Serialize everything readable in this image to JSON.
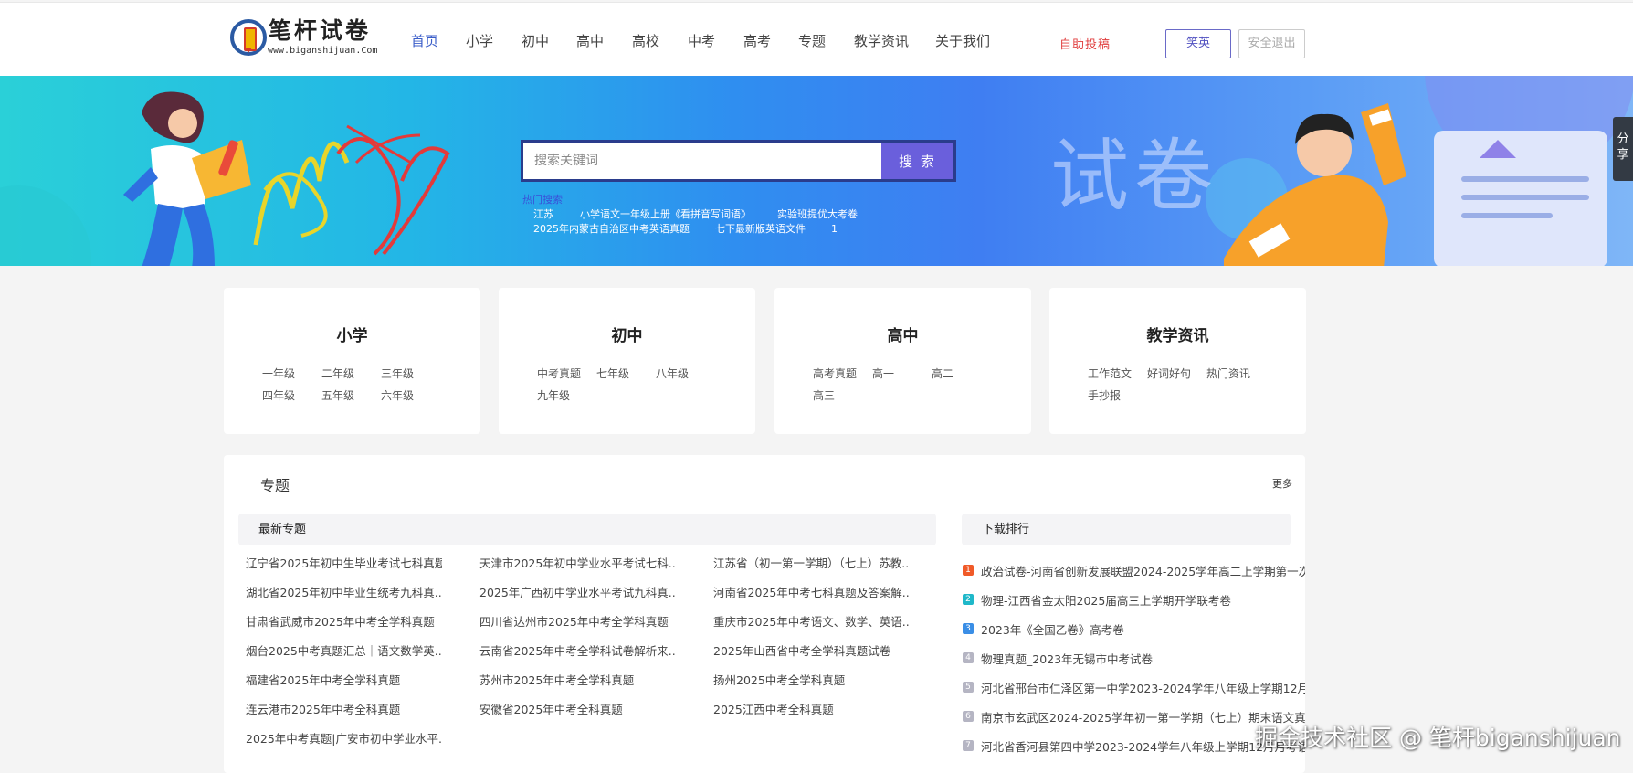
{
  "header": {
    "logo_text": "笔杆试卷",
    "logo_url": "www.biganshijuan.Com",
    "nav": [
      "首页",
      "小学",
      "初中",
      "高中",
      "高校",
      "中考",
      "高考",
      "专题",
      "教学资讯",
      "关于我们"
    ],
    "nav_active": "首页",
    "contribute": "自助投稿",
    "user_button": "笑英",
    "logout_button": "安全退出"
  },
  "banner": {
    "big_text": "试卷",
    "search_placeholder": "搜索关键词",
    "search_button": "搜 索",
    "hot_label": "热门搜索",
    "hot_links_row1": [
      "江苏",
      "小学语文一年级上册《看拼音写词语》",
      "实验班提优大考卷"
    ],
    "hot_links_row2": [
      "2025年内蒙古自治区中考英语真题",
      "七下最新版英语文件",
      "1"
    ],
    "share_label": "分享"
  },
  "cards": [
    {
      "title": "小学",
      "links": [
        "一年级",
        "二年级",
        "三年级",
        "四年级",
        "五年级",
        "六年级"
      ]
    },
    {
      "title": "初中",
      "links": [
        "中考真题",
        "七年级",
        "八年级",
        "九年级"
      ]
    },
    {
      "title": "高中",
      "links": [
        "高考真题",
        "高一",
        "高二",
        "高三"
      ]
    },
    {
      "title": "教学资讯",
      "links": [
        "工作范文",
        "好词好句",
        "热门资讯",
        "手抄报"
      ]
    }
  ],
  "topics_panel": {
    "title": "专题",
    "more": "更多",
    "latest_header": "最新专题",
    "ranking_header": "下载排行",
    "topics": [
      "辽宁省2025年初中生毕业考试七科真题",
      "天津市2025年初中学业水平考试七科...",
      "江苏省（初一第一学期）（七上）苏教...",
      "湖北省2025年初中毕业生统考九科真...",
      "2025年广西初中学业水平考试九科真...",
      "河南省2025年中考七科真题及答案解...",
      "甘肃省武威市2025年中考全学科真题",
      "四川省达州市2025年中考全学科真题",
      "重庆市2025年中考语文、数学、英语...",
      "烟台2025中考真题汇总｜语文数学英...",
      "云南省2025年中考全学科试卷解析来...",
      "2025年山西省中考全学科真题试卷",
      "福建省2025年中考全学科真题",
      "苏州市2025年中考全学科真题",
      "扬州2025中考全学科真题",
      "连云港市2025年中考全科真题",
      "安徽省2025年中考全科真题",
      "2025江西中考全科真题",
      "2025年中考真题|广安市初中学业水平..."
    ],
    "ranking": [
      {
        "num": "1",
        "text": "政治试卷-河南省创新发展联盟2024-2025学年高二上学期第一次"
      },
      {
        "num": "2",
        "text": "物理-江西省金太阳2025届高三上学期开学联考卷"
      },
      {
        "num": "3",
        "text": "2023年《全国乙卷》高考卷"
      },
      {
        "num": "4",
        "text": "物理真题_2023年无锡市中考试卷"
      },
      {
        "num": "5",
        "text": "河北省邢台市仁泽区第一中学2023-2024学年八年级上学期12月"
      },
      {
        "num": "6",
        "text": "南京市玄武区2024-2025学年初一第一学期（七上）期末语文真"
      },
      {
        "num": "7",
        "text": "河北省香河县第四中学2023-2024学年八年级上学期12月月考语"
      }
    ],
    "rank_colors": [
      "#f05a28",
      "#1fb8c9",
      "#3a8ee6",
      "#b5b5c3",
      "#b5b5c3",
      "#b5b5c3",
      "#b5b5c3"
    ]
  },
  "watermark": "掘金技术社区 @ 笔杆biganshijuan",
  "colors": {
    "accent": "#3b5ec9",
    "search_button": "#6a5fdc",
    "contribute": "#e03c3c"
  }
}
